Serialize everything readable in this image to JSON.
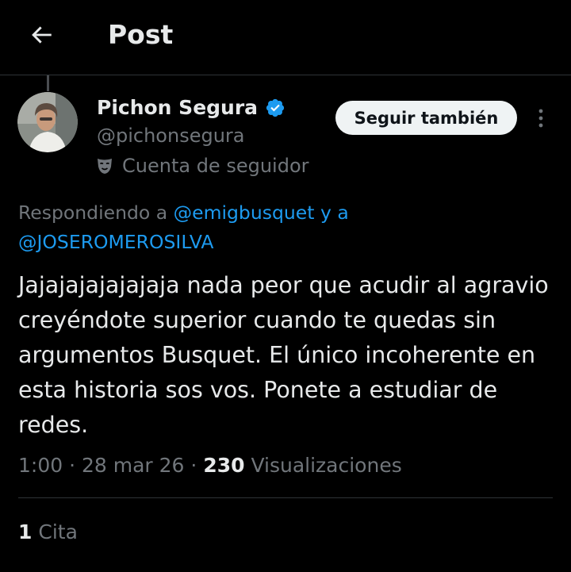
{
  "header": {
    "title": "Post"
  },
  "author": {
    "name": "Pichon Segura",
    "handle": "@pichonsegura",
    "account_label": "Cuenta de seguidor",
    "verified_color": "#1d9bf0"
  },
  "follow_button": {
    "label": "Seguir también"
  },
  "reply_context": {
    "prefix": "Respondiendo a",
    "first_mention": "@emigbusquet",
    "connector": "y a",
    "second_mention": "@JOSEROMEROSILVA"
  },
  "tweet": {
    "text": "Jajajajajajajaja nada peor que acudir al agravio creyéndote superior cuando te quedas sin argumentos Busquet. El único incoherente en esta historia sos vos. Ponete a estudiar de redes."
  },
  "meta": {
    "time": "1:00",
    "separator": "·",
    "date": "28 mar 26",
    "views_count": "230",
    "views_label": "Visualizaciones"
  },
  "stats": {
    "quotes_count": "1",
    "quotes_label": "Cita"
  },
  "icons": {
    "back": "back-arrow-icon",
    "verified": "verified-badge-icon",
    "account_label": "theater-mask-icon",
    "more": "more-vertical-icon"
  },
  "colors": {
    "accent": "#1d9bf0",
    "background": "#000000",
    "secondary_text": "#71767b"
  }
}
